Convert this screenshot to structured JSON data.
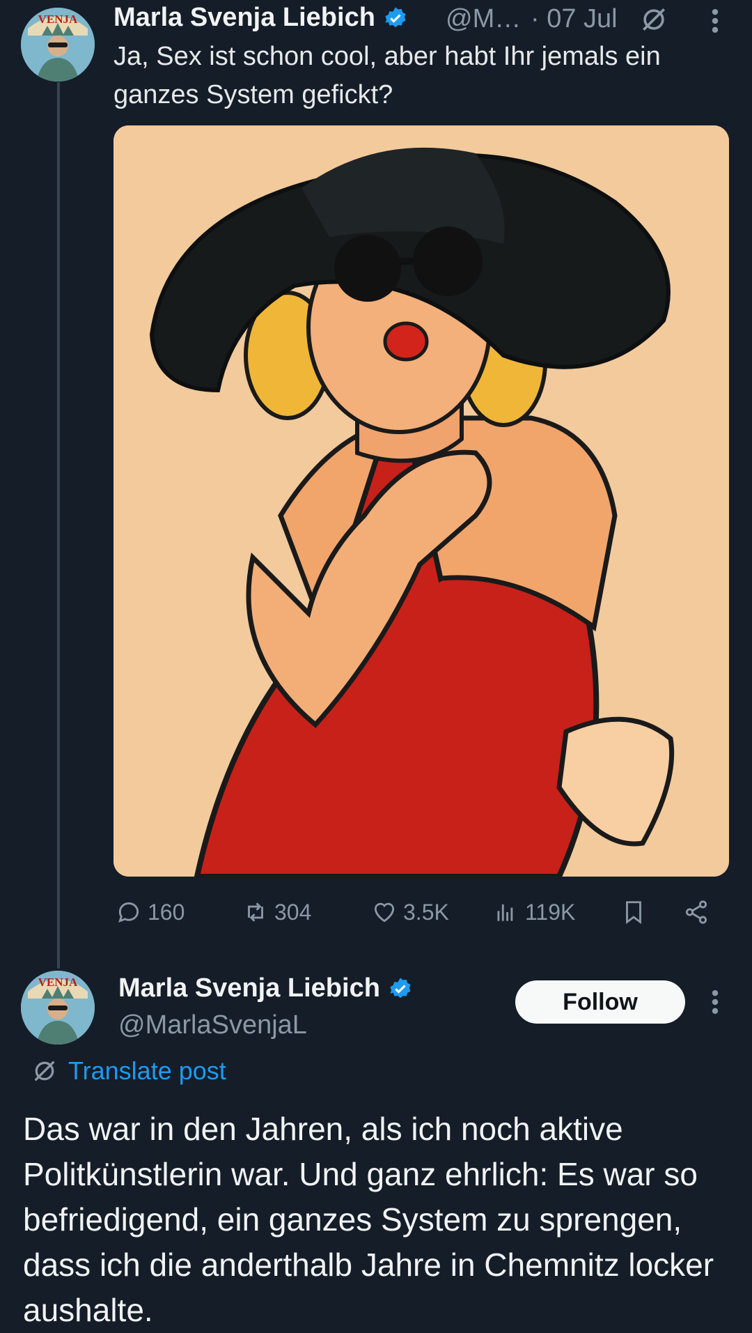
{
  "tweet1": {
    "author_name": "Marla Svenja Liebich",
    "handle": "@M…",
    "date": "· 07 Jul",
    "text": "Ja, Sex ist schon cool, aber habt Ihr jemals ein ganzes System gefickt?",
    "avatar_text": "VENJA",
    "stats": {
      "replies": "160",
      "reposts": "304",
      "likes": "3.5K",
      "views": "119K"
    }
  },
  "tweet2": {
    "author_name": "Marla Svenja Liebich",
    "handle": "@MarlaSvenjaL",
    "avatar_text": "VENJA",
    "follow_label": "Follow",
    "translate_label": "Translate post",
    "text": "Das war in den Jahren, als ich noch aktive Politkünstlerin war. Und ganz ehrlich: Es war so befriedigend, ein ganzes System zu sprengen, dass ich die anderthalb Jahre in Chemnitz locker aushalte."
  },
  "colors": {
    "background": "#151d28",
    "accent": "#1d9bf0",
    "muted": "#8b98a5"
  },
  "icons": [
    "verified-badge-icon",
    "translate-icon",
    "more-icon",
    "reply-icon",
    "repost-icon",
    "like-icon",
    "views-icon",
    "bookmark-icon",
    "share-icon"
  ]
}
